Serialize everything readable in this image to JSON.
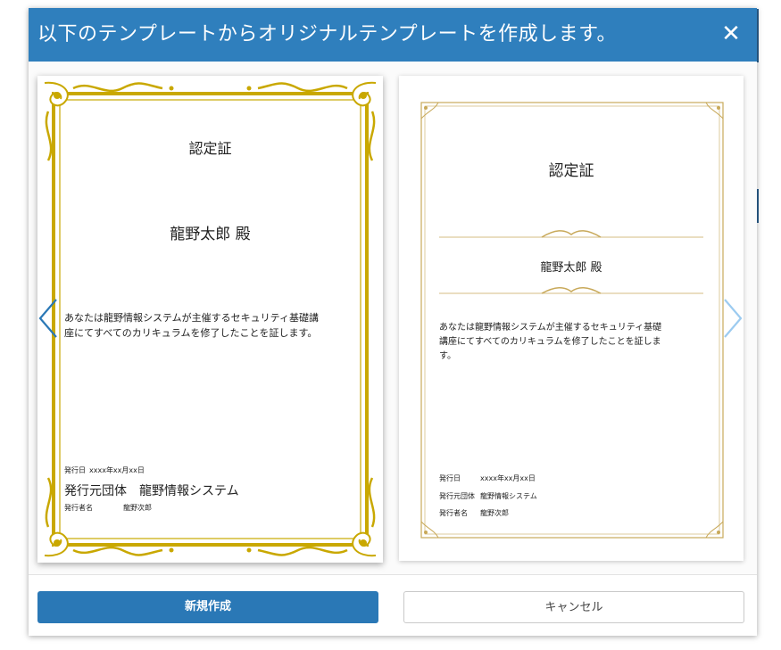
{
  "dialog": {
    "title": "以下のテンプレートからオリジナルテンプレートを作成します。",
    "close_label": "✕"
  },
  "templates": [
    {
      "heading": "認定証",
      "recipient": "龍野太郎 殿",
      "body_line1": "あなたは龍野情報システムが主催するセキュリティ基礎講",
      "body_line2": "座にてすべてのカリキュラムを修了したことを証します。",
      "issue_date_label": "発行日",
      "issue_date_value": "xxxx年xx月xx日",
      "org_label": "発行元団体",
      "org_value": "龍野情報システム",
      "issuer_label": "発行者名",
      "issuer_value": "龍野次郎",
      "frame_color": "#c9a800"
    },
    {
      "heading": "認定証",
      "recipient": "龍野太郎 殿",
      "body_line1": "あなたは龍野情報システムが主催するセキュリティ基礎",
      "body_line2": "講座にてすべてのカリキュラムを修了したことを証しま",
      "body_line3": "す。",
      "issue_date_label": "発行日",
      "issue_date_value": "xxxx年xx月xx日",
      "org_label": "発行元団体",
      "org_value": "龍野情報システム",
      "issuer_label": "発行者名",
      "issuer_value": "龍野次郎",
      "frame_color": "#c8a95a"
    }
  ],
  "buttons": {
    "create_label": "新規作成",
    "cancel_label": "キャンセル"
  },
  "colors": {
    "header_bg": "#2f7fbd",
    "primary_button": "#2a78b6",
    "nav_prev": "#2a78b6",
    "nav_next": "#9ccbf0"
  }
}
